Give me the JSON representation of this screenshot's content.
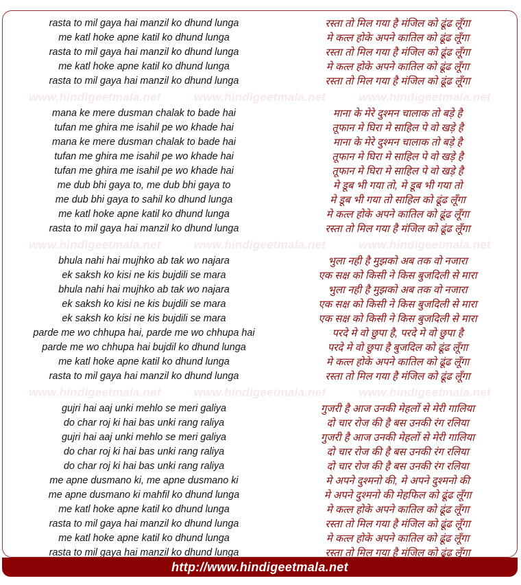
{
  "footer": {
    "url": "http://www.hindigeetmala.net"
  },
  "watermark": {
    "text": "www.hindigeetmala.net",
    "repeat": 3,
    "color": "#f6e9e9"
  },
  "colors": {
    "frame_border": "#a03030",
    "devanagari_text": "#8b1010",
    "roman_text": "#141414",
    "footer_bar": "#8b0000",
    "footer_text": "#ffffff"
  },
  "stanzas": [
    {
      "roman": [
        "rasta to mil gaya hai manzil ko dhund lunga",
        "me katl hoke apne katil ko dhund lunga",
        "rasta to mil gaya hai manzil ko dhund lunga",
        "me katl hoke apne katil ko dhund lunga",
        "rasta to mil gaya hai manzil ko dhund lunga"
      ],
      "devanagari": [
        "रस्ता तो मिल गया है मंजिल को ढूंढ लूँगा",
        "मे कत्ल होके अपने कातिल को ढूंढ लूँगा",
        "रस्ता तो मिल गया है मंजिल को ढूंढ लूँगा",
        "मे कत्ल होके अपने कातिल को ढूंढ लूँगा",
        "रस्ता तो मिल गया है मंजिल को ढूंढ लूँगा"
      ]
    },
    {
      "roman": [
        "mana ke mere dusman chalak to bade hai",
        "tufan me ghira me isahil pe wo khade hai",
        "mana ke mere dusman chalak to bade hai",
        "tufan me ghira me isahil pe wo khade hai",
        "tufan me ghira me isahil pe wo khade hai",
        "me dub bhi gaya to, me dub bhi gaya to",
        "me dub bhi gaya to sahil ko dhund lunga",
        "me katl hoke apne katil ko dhund lunga",
        "rasta to mil gaya hai manzil ko dhund lunga"
      ],
      "devanagari": [
        "माना के मेरे दुश्मन चालाक तो बड़े है",
        "तूफान मे घिरा मे साहिल पे वो खड़े है",
        "माना के मेरे दुश्मन चालाक तो बड़े है",
        "तूफान मे घिरा मे साहिल पे वो खड़े है",
        "तूफान मे घिरा मे साहिल पे वो खड़े है",
        "मे डूब भी गया तो, मे डूब भी गया तो",
        "मे डूब भी गया तो साहिल को ढूंढ लूँगा",
        "मे कत्ल होके अपने कातिल को ढूंढ लूँगा",
        "रस्ता तो मिल गया है मंजिल को ढूंढ लूँगा"
      ]
    },
    {
      "roman": [
        "bhula nahi hai mujhko ab tak wo najara",
        "ek saksh ko kisi ne kis bujdili se mara",
        "bhula nahi hai mujhko ab tak wo najara",
        "ek saksh ko kisi ne kis bujdili se mara",
        "ek saksh ko kisi ne kis bujdili se mara",
        "parde me wo chhupa hai, parde me wo chhupa hai",
        "parde me wo chhupa hai bujdil ko dhund lunga",
        "me katl hoke apne katil ko dhund lunga",
        "rasta to mil gaya hai manzil ko dhund lunga"
      ],
      "devanagari": [
        "भुला नही है मुझको अब तक वो नजारा",
        "एक सक्ष को किसी ने किस बुजदिली से मारा",
        "भुला नही है मुझको अब तक वो नजारा",
        "एक सक्ष को किसी ने किस बुजदिली से मारा",
        "एक सक्ष को किसी ने किस बुजदिली से मारा",
        "परदे मे वो छुपा है, परदे मे वो छुपा है",
        "परदे मे वो छुपा है बुजदिल को ढूंढ लूँगा",
        "मे कत्ल होके अपने कातिल को ढूंढ लूँगा",
        "रस्ता तो मिल गया है मंजिल को ढूंढ लूँगा"
      ]
    },
    {
      "roman": [
        "gujri hai aaj unki mehlo se meri galiya",
        "do char roj ki hai bas unki rang raliya",
        "gujri hai aaj unki mehlo se meri galiya",
        "do char roj ki hai bas unki rang raliya",
        "do char roj ki hai bas unki rang raliya",
        "me apne dusmano ki, me apne dusmano ki",
        "me apne dusmano ki mahfil ko dhund lunga",
        "me katl hoke apne katil ko dhund lunga",
        "rasta to mil gaya hai manzil ko dhund lunga",
        "me katl hoke apne katil ko dhund lunga",
        "rasta to mil gaya hai manzil ko dhund lunga"
      ],
      "devanagari": [
        "गुजरी है आज उनकी मेहलों से मेरी गालिया",
        "दो चार रोज की है बस उनकी रंग रलिया",
        "गुजरी है आज उनकी मेहलों से मेरी गालिया",
        "दो चार रोज की है बस उनकी रंग रलिया",
        "दो चार रोज की है बस उनकी रंग रलिया",
        "मे अपने दुश्मनो की, मे अपने दुश्मनो की",
        "मे अपने दुश्मनो की मेहफिल को ढूंढ लूँगा",
        "मे कत्ल होके अपने कातिल को ढूंढ लूँगा",
        "रस्ता तो मिल गया है मंजिल को ढूंढ लूँगा",
        "मे कत्ल होके अपने कातिल को ढूंढ लूँगा",
        "रस्ता तो मिल गया है मंजिल को ढूंढ लूँगा"
      ]
    }
  ]
}
